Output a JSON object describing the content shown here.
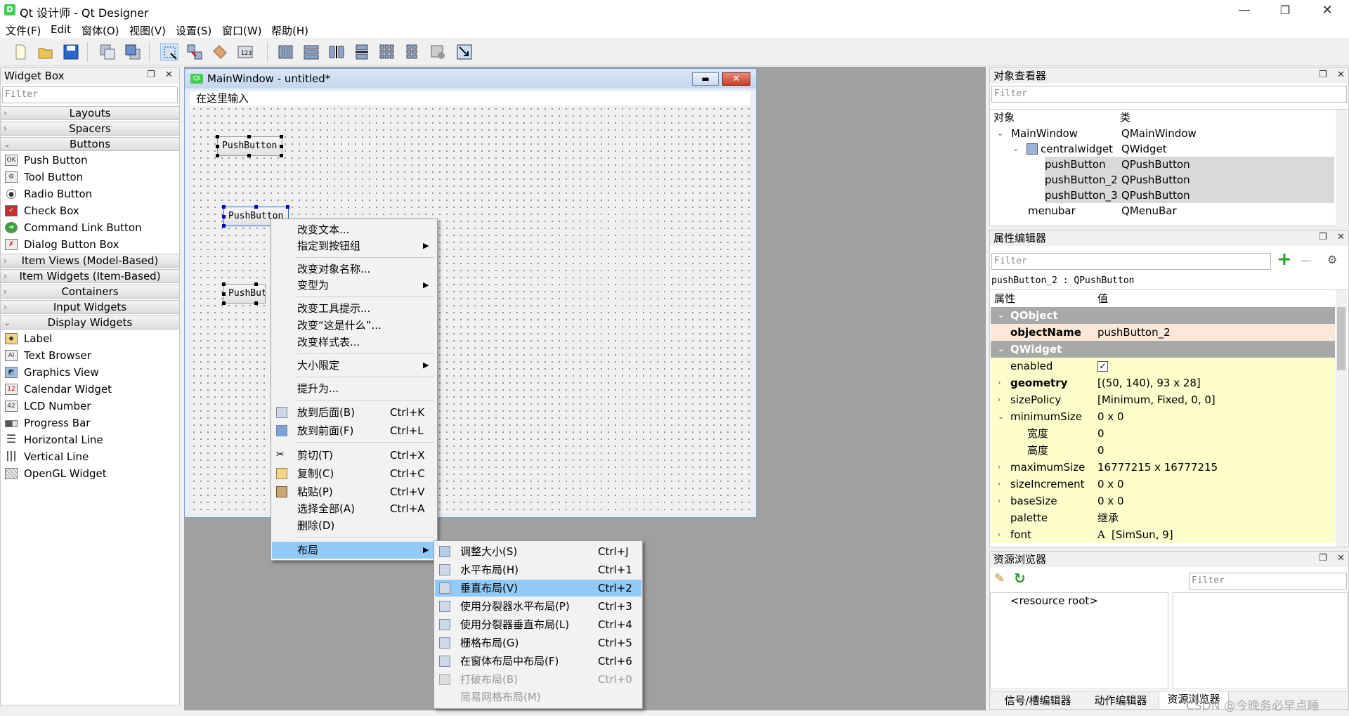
{
  "window": {
    "title": "Qt 设计师 - Qt Designer",
    "icon": "D",
    "minimize": "—",
    "maximize": "❐",
    "close": "✕"
  },
  "menu": [
    "文件(F)",
    "Edit",
    "窗体(O)",
    "视图(V)",
    "设置(S)",
    "窗口(W)",
    "帮助(H)"
  ],
  "widget_box": {
    "title": "Widget Box",
    "filter_placeholder": "Filter",
    "categories": {
      "layouts": "Layouts",
      "spacers": "Spacers",
      "buttons": "Buttons",
      "item_views": "Item Views (Model-Based)",
      "item_widgets": "Item Widgets (Item-Based)",
      "containers": "Containers",
      "input_widgets": "Input Widgets",
      "display_widgets": "Display Widgets"
    },
    "buttons": [
      "Push Button",
      "Tool Button",
      "Radio Button",
      "Check Box",
      "Command Link Button",
      "Dialog Button Box"
    ],
    "display_widgets": [
      "Label",
      "Text Browser",
      "Graphics View",
      "Calendar Widget",
      "LCD Number",
      "Progress Bar",
      "Horizontal Line",
      "Vertical Line",
      "OpenGL Widget"
    ]
  },
  "form": {
    "title": "MainWindow - untitled*",
    "icon": "Qt",
    "menu_placeholder": "在这里输入",
    "buttons": [
      "PushButton",
      "PushButton",
      "PushButt"
    ]
  },
  "context_menu": {
    "items": [
      {
        "label": "改变文本...",
        "shortcut": ""
      },
      {
        "label": "指定到按钮组",
        "shortcut": "",
        "submenu": true
      },
      {
        "label": "改变对象名称...",
        "shortcut": ""
      },
      {
        "label": "变型为",
        "shortcut": "",
        "submenu": true
      },
      {
        "label": "改变工具提示...",
        "shortcut": ""
      },
      {
        "label": "改变“这是什么”...",
        "shortcut": ""
      },
      {
        "label": "改变样式表...",
        "shortcut": ""
      },
      {
        "label": "大小限定",
        "shortcut": "",
        "submenu": true
      },
      {
        "label": "提升为...",
        "shortcut": ""
      },
      {
        "label": "放到后面(B)",
        "shortcut": "Ctrl+K"
      },
      {
        "label": "放到前面(F)",
        "shortcut": "Ctrl+L"
      },
      {
        "label": "剪切(T)",
        "shortcut": "Ctrl+X"
      },
      {
        "label": "复制(C)",
        "shortcut": "Ctrl+C"
      },
      {
        "label": "粘贴(P)",
        "shortcut": "Ctrl+V"
      },
      {
        "label": "选择全部(A)",
        "shortcut": "Ctrl+A"
      },
      {
        "label": "删除(D)",
        "shortcut": ""
      },
      {
        "label": "布局",
        "shortcut": "",
        "submenu": true
      }
    ]
  },
  "layout_submenu": {
    "items": [
      {
        "label": "调整大小(S)",
        "shortcut": "Ctrl+J"
      },
      {
        "label": "水平布局(H)",
        "shortcut": "Ctrl+1"
      },
      {
        "label": "垂直布局(V)",
        "shortcut": "Ctrl+2"
      },
      {
        "label": "使用分裂器水平布局(P)",
        "shortcut": "Ctrl+3"
      },
      {
        "label": "使用分裂器垂直布局(L)",
        "shortcut": "Ctrl+4"
      },
      {
        "label": "栅格布局(G)",
        "shortcut": "Ctrl+5"
      },
      {
        "label": "在窗体布局中布局(F)",
        "shortcut": "Ctrl+6"
      },
      {
        "label": "打破布局(B)",
        "shortcut": "Ctrl+0"
      },
      {
        "label": "简易网格布局(M)",
        "shortcut": ""
      }
    ]
  },
  "object_inspector": {
    "title": "对象查看器",
    "filter_placeholder": "Filter",
    "col_object": "对象",
    "col_class": "类",
    "rows": [
      {
        "name": "MainWindow",
        "cls": "QMainWindow"
      },
      {
        "name": "centralwidget",
        "cls": "QWidget"
      },
      {
        "name": "pushButton",
        "cls": "QPushButton"
      },
      {
        "name": "pushButton_2",
        "cls": "QPushButton"
      },
      {
        "name": "pushButton_3",
        "cls": "QPushButton"
      },
      {
        "name": "menubar",
        "cls": "QMenuBar"
      }
    ]
  },
  "property_editor": {
    "title": "属性编辑器",
    "filter_placeholder": "Filter",
    "add_icon": "+",
    "remove_icon": "—",
    "object_label": "pushButton_2 : QPushButton",
    "col_prop": "属性",
    "col_value": "值",
    "group_qobject": "QObject",
    "group_qwidget": "QWidget",
    "rows": [
      {
        "name": "objectName",
        "value": "pushButton_2"
      },
      {
        "name": "enabled",
        "value": "✓"
      },
      {
        "name": "geometry",
        "value": "[(50, 140), 93 x 28]"
      },
      {
        "name": "sizePolicy",
        "value": "[Minimum, Fixed, 0, 0]"
      },
      {
        "name": "minimumSize",
        "value": "0 x 0"
      },
      {
        "name": "宽度",
        "value": "0"
      },
      {
        "name": "高度",
        "value": "0"
      },
      {
        "name": "maximumSize",
        "value": "16777215 x 16777215"
      },
      {
        "name": "sizeIncrement",
        "value": "0 x 0"
      },
      {
        "name": "baseSize",
        "value": "0 x 0"
      },
      {
        "name": "palette",
        "value": "继承"
      },
      {
        "name": "font",
        "value": "[SimSun, 9]"
      }
    ],
    "font_glyph": "A"
  },
  "resource_browser": {
    "title": "资源浏览器",
    "filter_placeholder": "Filter",
    "root": "<resource root>",
    "tabs": [
      "信号/槽编辑器",
      "动作编辑器",
      "资源浏览器"
    ]
  },
  "watermark": "CSDN @今晚务必早点睡",
  "colors": {
    "accent": "#91c9f7",
    "property_yellow": "#fdfccb",
    "group_gray": "#a8a8a8"
  }
}
